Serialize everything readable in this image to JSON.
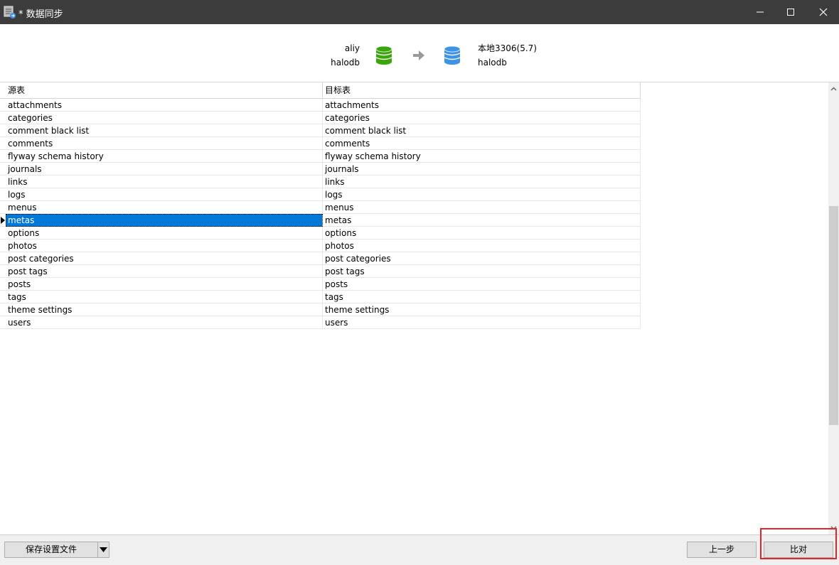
{
  "window": {
    "title": "* 数据同步",
    "icons": {
      "app": "database-sync-icon",
      "minimize": "minimize-icon",
      "maximize": "maximize-icon",
      "close": "close-icon"
    }
  },
  "connections": {
    "source": {
      "server": "aliy",
      "database": "halodb",
      "icon": "database-icon",
      "color": "#3aa60c"
    },
    "target": {
      "server": "本地3306(5.7)",
      "database": "halodb",
      "icon": "database-icon",
      "color": "#3d93e8"
    },
    "arrow_icon": "arrow-right-icon"
  },
  "grid": {
    "headers": {
      "source": "源表",
      "target": "目标表"
    },
    "selected_index": 9,
    "rows": [
      {
        "source": "attachments",
        "target": "attachments"
      },
      {
        "source": "categories",
        "target": "categories"
      },
      {
        "source": "comment black list",
        "target": "comment black list"
      },
      {
        "source": "comments",
        "target": "comments"
      },
      {
        "source": "flyway schema history",
        "target": "flyway schema history"
      },
      {
        "source": "journals",
        "target": "journals"
      },
      {
        "source": "links",
        "target": "links"
      },
      {
        "source": "logs",
        "target": "logs"
      },
      {
        "source": "menus",
        "target": "menus"
      },
      {
        "source": "metas",
        "target": "metas"
      },
      {
        "source": "options",
        "target": "options"
      },
      {
        "source": "photos",
        "target": "photos"
      },
      {
        "source": "post categories",
        "target": "post categories"
      },
      {
        "source": "post tags",
        "target": "post tags"
      },
      {
        "source": "posts",
        "target": "posts"
      },
      {
        "source": "tags",
        "target": "tags"
      },
      {
        "source": "theme settings",
        "target": "theme settings"
      },
      {
        "source": "users",
        "target": "users"
      }
    ]
  },
  "footer": {
    "save_label": "保存设置文件",
    "prev_label": "上一步",
    "compare_label": "比对"
  },
  "colors": {
    "selection": "#0078d7",
    "highlight": "#e0262b",
    "titlebar": "#3c3c3c"
  }
}
